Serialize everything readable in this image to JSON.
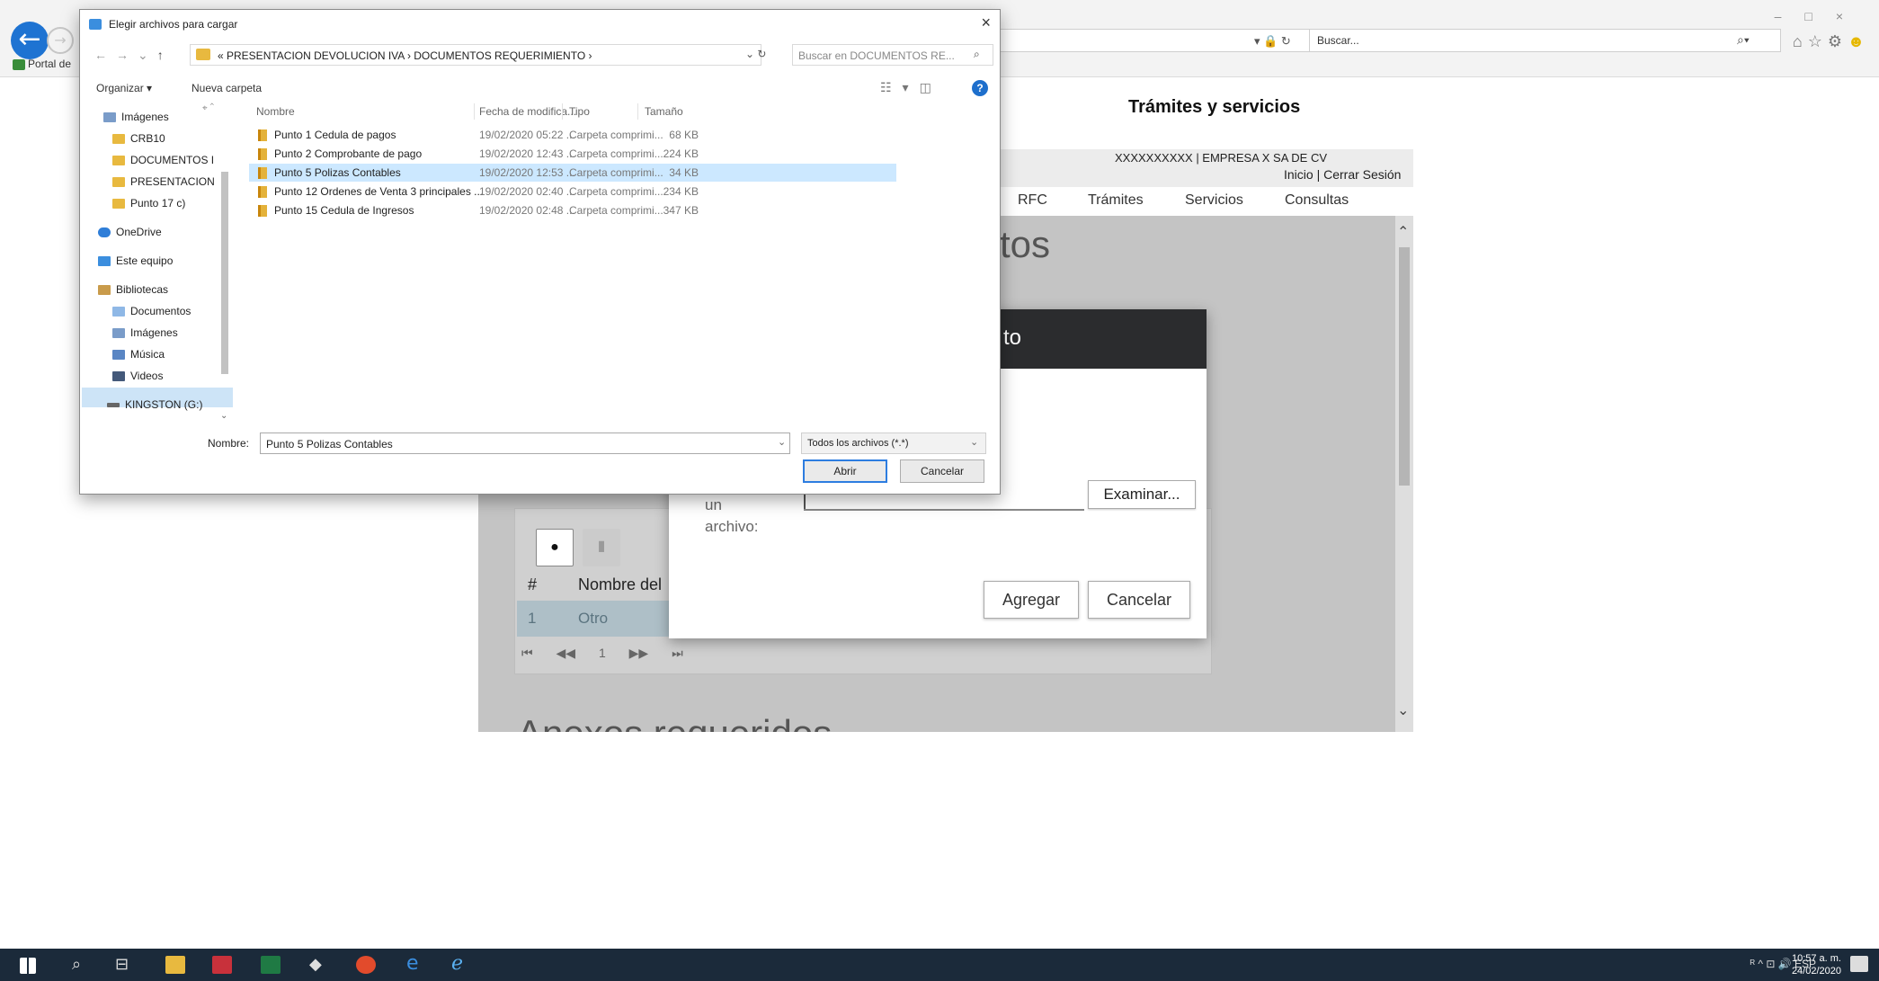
{
  "browser": {
    "tab_label": "Portal de",
    "search_placeholder": "Buscar...",
    "addr_controls": "▾ 🔒 ↻",
    "search_go": "⌕▾",
    "window_controls": "–□×"
  },
  "page": {
    "heading": "Trámites y servicios",
    "user_line": "XXXXXXXXXX  |  EMPRESA X SA DE CV",
    "session_links": "Inicio | Cerrar Sesión",
    "nav": [
      "RFC",
      "Trámites",
      "Servicios",
      "Consultas"
    ],
    "section_heading_partial": "tos",
    "section_heading_bottom": "Anexos requeridos",
    "table_headers": [
      "#",
      "Nombre del"
    ],
    "table_rows": [
      {
        "num": "1",
        "name": "Otro"
      }
    ],
    "pager": [
      "⏮",
      "◀◀",
      "1",
      "▶▶",
      "⏭"
    ]
  },
  "modal": {
    "title_partial": "to",
    "label": "un archivo:",
    "examinar": "Examinar...",
    "agregar": "Agregar",
    "cancelar": "Cancelar"
  },
  "dialog": {
    "title": "Elegir archivos para cargar",
    "path": "« PRESENTACION DEVOLUCION IVA  ›  DOCUMENTOS REQUERIMIENTO  ›",
    "search_placeholder": "Buscar en DOCUMENTOS RE...",
    "organizar": "Organizar ▾",
    "nueva_carpeta": "Nueva carpeta",
    "nav_items": [
      {
        "label": "Imágenes",
        "icon": "img"
      },
      {
        "label": "CRB10",
        "icon": "folder"
      },
      {
        "label": "DOCUMENTOS I",
        "icon": "folder"
      },
      {
        "label": "PRESENTACION",
        "icon": "folder"
      },
      {
        "label": "Punto 17 c)",
        "icon": "folder"
      },
      {
        "label": "OneDrive",
        "icon": "cloud"
      },
      {
        "label": "Este equipo",
        "icon": "pc"
      },
      {
        "label": "Bibliotecas",
        "icon": "lib"
      },
      {
        "label": "Documentos",
        "icon": "doc"
      },
      {
        "label": "Imágenes",
        "icon": "img"
      },
      {
        "label": "Música",
        "icon": "music"
      },
      {
        "label": "Videos",
        "icon": "video"
      },
      {
        "label": "KINGSTON (G:)",
        "icon": "drive"
      }
    ],
    "columns": [
      "Nombre",
      "Fecha de modifica...",
      "Tipo",
      "Tamaño"
    ],
    "files": [
      {
        "name": "Punto 1 Cedula de pagos",
        "date": "19/02/2020 05:22 ...",
        "type": "Carpeta comprimi...",
        "size": "68 KB",
        "selected": false
      },
      {
        "name": "Punto 2 Comprobante de pago",
        "date": "19/02/2020 12:43 ...",
        "type": "Carpeta comprimi...",
        "size": "224 KB",
        "selected": false
      },
      {
        "name": "Punto 5 Polizas Contables",
        "date": "19/02/2020 12:53 ...",
        "type": "Carpeta comprimi...",
        "size": "34 KB",
        "selected": true
      },
      {
        "name": "Punto 12 Ordenes de Venta 3 principales ...",
        "date": "19/02/2020 02:40 ...",
        "type": "Carpeta comprimi...",
        "size": "234 KB",
        "selected": false
      },
      {
        "name": "Punto 15 Cedula de Ingresos",
        "date": "19/02/2020 02:48 ...",
        "type": "Carpeta comprimi...",
        "size": "347 KB",
        "selected": false
      }
    ],
    "name_label": "Nombre:",
    "name_value": "Punto 5 Polizas Contables",
    "filter_value": "Todos los archivos (*.*)",
    "abrir": "Abrir",
    "cancelar": "Cancelar"
  },
  "taskbar": {
    "tray": "ᴿ ^ ⊡ 🔊 ESP",
    "time": "10:57 a. m.",
    "date": "24/02/2020"
  }
}
